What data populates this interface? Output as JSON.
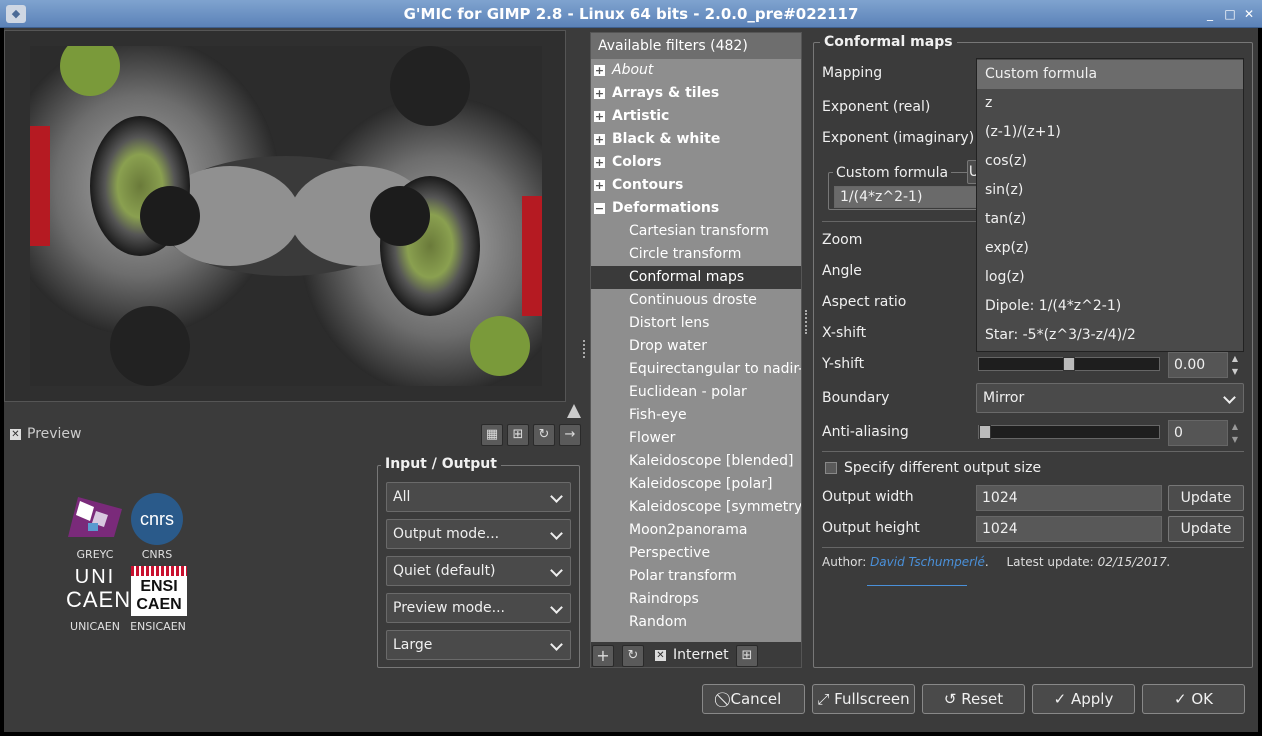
{
  "window": {
    "title": "G'MIC for GIMP 2.8 - Linux 64 bits - 2.0.0_pre#022117"
  },
  "preview": {
    "label": "Preview",
    "checked": true
  },
  "logos": [
    {
      "name": "GREYC"
    },
    {
      "name": "CNRS",
      "text": "cnrs"
    },
    {
      "name": "UNICAEN",
      "text1": "UNI",
      "text2": "CAEN"
    },
    {
      "name": "ENSICAEN",
      "text1": "ENSI",
      "text2": "CAEN"
    }
  ],
  "io": {
    "title": "Input / Output",
    "combos": [
      "All",
      "Output mode...",
      "Quiet (default)",
      "Preview mode...",
      "Large"
    ]
  },
  "filters": {
    "header": "Available filters (482)",
    "categories": [
      "About",
      "Arrays & tiles",
      "Artistic",
      "Black & white",
      "Colors",
      "Contours",
      "Deformations"
    ],
    "items": [
      "Cartesian transform",
      "Circle transform",
      "Conformal maps",
      "Continuous droste",
      "Distort lens",
      "Drop water",
      "Equirectangular to nadir-",
      "Euclidean - polar",
      "Fish-eye",
      "Flower",
      "Kaleidoscope [blended]",
      "Kaleidoscope [polar]",
      "Kaleidoscope [symmetry]",
      "Moon2panorama",
      "Perspective",
      "Polar transform",
      "Raindrops",
      "Random"
    ],
    "selected": "Conformal maps",
    "internet_label": "Internet"
  },
  "params": {
    "title": "Conformal maps",
    "mapping_label": "Mapping",
    "exp_real_label": "Exponent (real)",
    "exp_imag_label": "Exponent (imaginary)",
    "custom_formula_title": "Custom formula",
    "custom_formula_btn": "U",
    "custom_formula_value": "1/(4*z^2-1)",
    "zoom_label": "Zoom",
    "angle_label": "Angle",
    "aspect_label": "Aspect ratio",
    "xshift_label": "X-shift",
    "yshift_label": "Y-shift",
    "yshift_value": "0.00",
    "yshift_level": 0.5,
    "boundary_label": "Boundary",
    "boundary_value": "Mirror",
    "aa_label": "Anti-aliasing",
    "aa_value": "0",
    "aa_level": 0,
    "specify_output_label": "Specify different output size",
    "specify_output_checked": false,
    "out_width_label": "Output width",
    "out_width_value": "1024",
    "out_height_label": "Output height",
    "out_height_value": "1024",
    "update_label": "Update",
    "author_prefix": "Author:",
    "author_name": "David Tschumperlé",
    "update_prefix": "Latest update:",
    "update_date": "02/15/2017."
  },
  "mapping_dropdown": {
    "options": [
      "Custom formula",
      "z",
      "(z-1)/(z+1)",
      "cos(z)",
      "sin(z)",
      "tan(z)",
      "exp(z)",
      "log(z)",
      "Dipole: 1/(4*z^2-1)",
      "Star: -5*(z^3/3-z/4)/2"
    ],
    "highlighted": "Custom formula"
  },
  "buttons": {
    "cancel": "Cancel",
    "fullscreen": "Fullscreen",
    "reset": "Reset",
    "apply": "Apply",
    "ok": "OK"
  },
  "colors": {
    "accent": "#5b82b8",
    "link": "#4a90d9",
    "selection": "#3a3a3a"
  }
}
